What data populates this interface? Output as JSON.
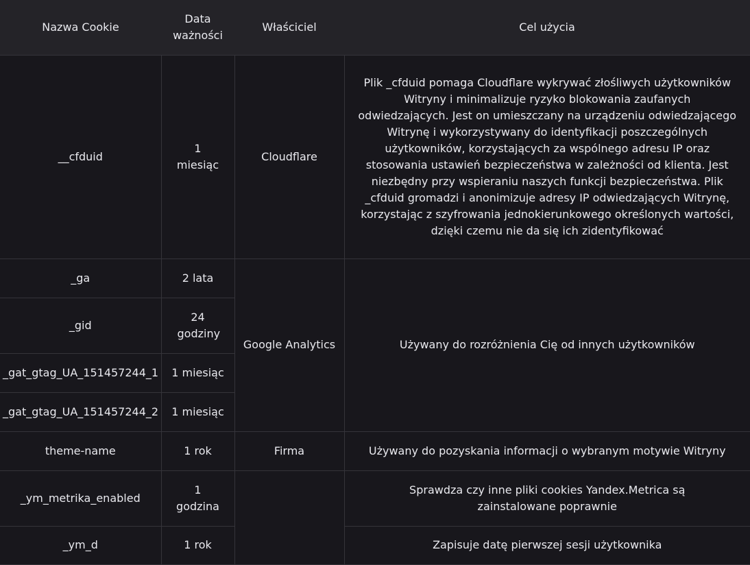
{
  "table": {
    "headers": {
      "name": "Nazwa Cookie",
      "expiry": "Data ważności",
      "owner": "Właściciel",
      "purpose": "Cel użycia"
    },
    "rows": [
      {
        "name": "__cfduid",
        "expiry": "1 miesiąc",
        "owner": "Cloudflare",
        "purpose": "Plik _cfduid pomaga Cloudflare wykrywać złośliwych użytkowników Witryny i minimalizuje ryzyko blokowania zaufanych odwiedzających. Jest on umieszczany na urządzeniu odwiedzającego Witrynę i wykorzystywany do identyfikacji poszczególnych użytkowników, korzystających za wspólnego adresu IP oraz stosowania ustawień bezpieczeństwa w zależności od klienta. Jest niezbędny przy wspieraniu naszych funkcji bezpieczeństwa. Plik _cfduid gromadzi i anonimizuje adresy IP odwiedzających Witrynę, korzystając z szyfrowania jednokierunkowego określonych wartości, dzięki czemu nie da się ich zidentyfikować"
      },
      {
        "name": "_ga",
        "expiry": "2 lata",
        "owner": "Google Analytics",
        "purpose": "Używany do rozróżnienia Cię od innych użytkowników"
      },
      {
        "name": "_gid",
        "expiry": "24 godziny"
      },
      {
        "name": "_gat_gtag_UA_151457244_1",
        "expiry": "1 miesiąc"
      },
      {
        "name": "_gat_gtag_UA_151457244_2",
        "expiry": "1 miesiąc"
      },
      {
        "name": "theme-name",
        "expiry": "1 rok",
        "owner": "Firma",
        "purpose": "Używany do pozyskania informacji o wybranym motywie Witryny"
      },
      {
        "name": "_ym_metrika_enabled",
        "expiry": "1 godzina",
        "owner": "",
        "purpose": "Sprawdza czy inne pliki cookies Yandex.Metrica są zainstalowane poprawnie"
      },
      {
        "name": "_ym_d",
        "expiry": "1 rok",
        "purpose": "Zapisuje datę pierwszej sesji użytkownika"
      }
    ]
  }
}
